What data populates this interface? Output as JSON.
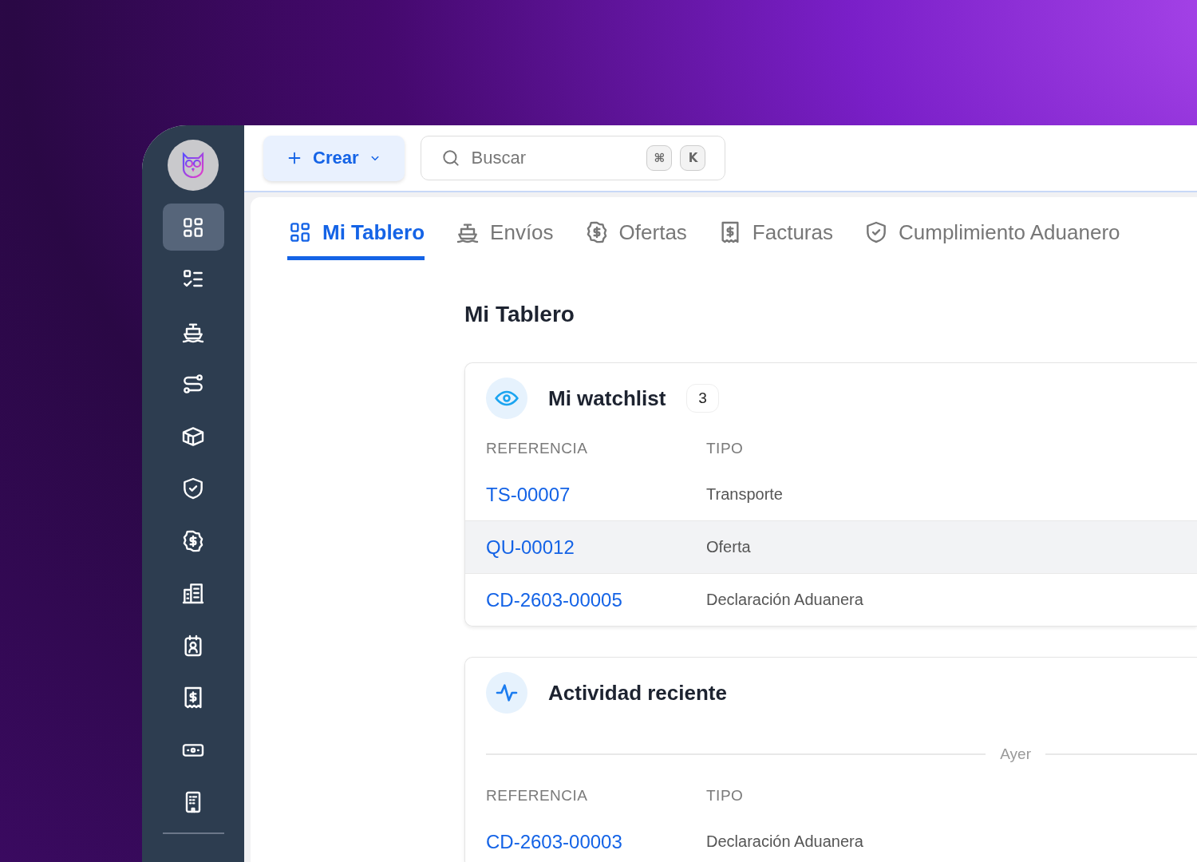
{
  "sidebar": {
    "items": [
      {
        "selected": true
      },
      {
        "selected": false
      },
      {
        "selected": false
      },
      {
        "selected": false
      },
      {
        "selected": false
      },
      {
        "selected": false
      },
      {
        "selected": false
      },
      {
        "selected": false
      },
      {
        "selected": false
      },
      {
        "selected": false
      },
      {
        "selected": false
      },
      {
        "selected": false
      }
    ]
  },
  "topbar": {
    "create_button": "Crear",
    "search": {
      "placeholder": "Buscar",
      "shortcut": [
        "⌘",
        "K"
      ]
    }
  },
  "tabs": [
    {
      "label": "Mi Tablero",
      "selected": true
    },
    {
      "label": "Envíos",
      "selected": false
    },
    {
      "label": "Ofertas",
      "selected": false
    },
    {
      "label": "Facturas",
      "selected": false
    },
    {
      "label": "Cumplimiento Aduanero",
      "selected": false
    }
  ],
  "page_title": "Mi Tablero",
  "watchlist": {
    "title": "Mi watchlist",
    "count": "3",
    "columns": [
      "REFERENCIA",
      "TIPO"
    ],
    "rows": [
      {
        "reference": "TS-00007",
        "type": "Transporte",
        "highlighted": false
      },
      {
        "reference": "QU-00012",
        "type": "Oferta",
        "highlighted": true
      },
      {
        "reference": "CD-2603-00005",
        "type": "Declaración Aduanera",
        "highlighted": false
      }
    ]
  },
  "activity": {
    "title": "Actividad reciente",
    "group_label": "Ayer",
    "columns": [
      "REFERENCIA",
      "TIPO"
    ],
    "rows": [
      {
        "reference": "CD-2603-00003",
        "type": "Declaración Aduanera",
        "highlighted": false
      }
    ]
  }
}
